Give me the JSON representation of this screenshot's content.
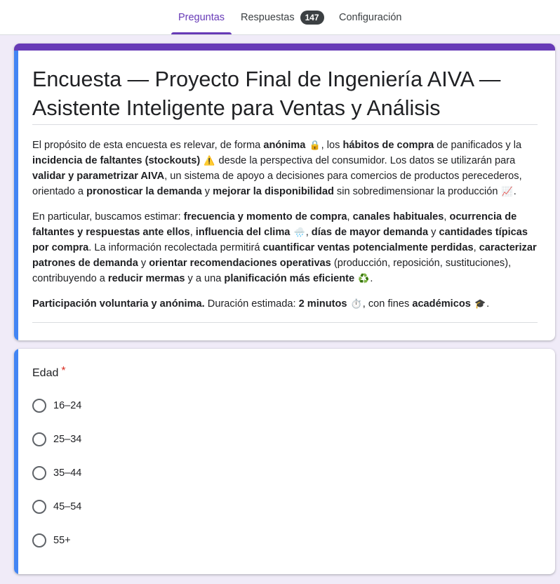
{
  "tabs": {
    "questions": "Preguntas",
    "responses": "Respuestas",
    "responses_count": "147",
    "settings": "Configuración"
  },
  "form": {
    "title": "Encuesta — Proyecto Final de Ingeniería AIVA — Asistente Inteligente para Ventas y Análisis",
    "p1": {
      "t1": "El propósito de esta encuesta es relevar, de forma ",
      "b1": "anónima",
      "e1": "🔒",
      "t2": ", los ",
      "b2": "hábitos de compra",
      "t3": " de panificados y la ",
      "b3": "incidencia de faltantes (stockouts)",
      "e2": "⚠️",
      "t4": " desde la perspectiva del consumidor. Los datos se utilizarán para ",
      "b4": "validar y parametrizar AIVA",
      "t5": ", un sistema de apoyo a decisiones para comercios de productos perecederos, orientado a ",
      "b5": "pronosticar la demanda",
      "t6": " y ",
      "b6": "mejorar la disponibilidad",
      "t7": " sin sobredimensionar la producción ",
      "e3": "📈",
      "t8": "."
    },
    "p2": {
      "t1": "En particular, buscamos estimar: ",
      "b1": "frecuencia y momento de compra",
      "t2": ", ",
      "b2": "canales habituales",
      "t3": ", ",
      "b3": "ocurrencia de faltantes y respuestas ante ellos",
      "t4": ", ",
      "b4": "influencia del clima",
      "e1": "🌧️",
      "t5": ", ",
      "b5": "días de mayor demanda",
      "t6": " y ",
      "b6": "cantidades típicas por compra",
      "t7": ". La información recolectada permitirá ",
      "b7": "cuantificar ventas potencialmente perdidas",
      "t8": ", ",
      "b8": "caracterizar patrones de demanda",
      "t9": " y ",
      "b9": "orientar recomendaciones operativas",
      "t10": " (producción, reposición, sustituciones), contribuyendo a ",
      "b10": "reducir mermas",
      "t11": " y a una ",
      "b11": "planificación más eficiente",
      "e2": "♻️",
      "t12": "."
    },
    "p3": {
      "b1": "Participación voluntaria y anónima.",
      "t1": " Duración estimada: ",
      "b2": "2 minutos",
      "e1": "⏱️",
      "t2": ", con fines ",
      "b3": "académicos",
      "e2": "🎓",
      "t3": "."
    }
  },
  "question": {
    "title": "Edad",
    "required_mark": "*",
    "options": [
      "16–24",
      "25–34",
      "35–44",
      "45–54",
      "55+"
    ]
  },
  "colors": {
    "accent": "#673ab7",
    "question_bar": "#4285f4",
    "background": "#f0ebf8",
    "required": "#d93025"
  }
}
